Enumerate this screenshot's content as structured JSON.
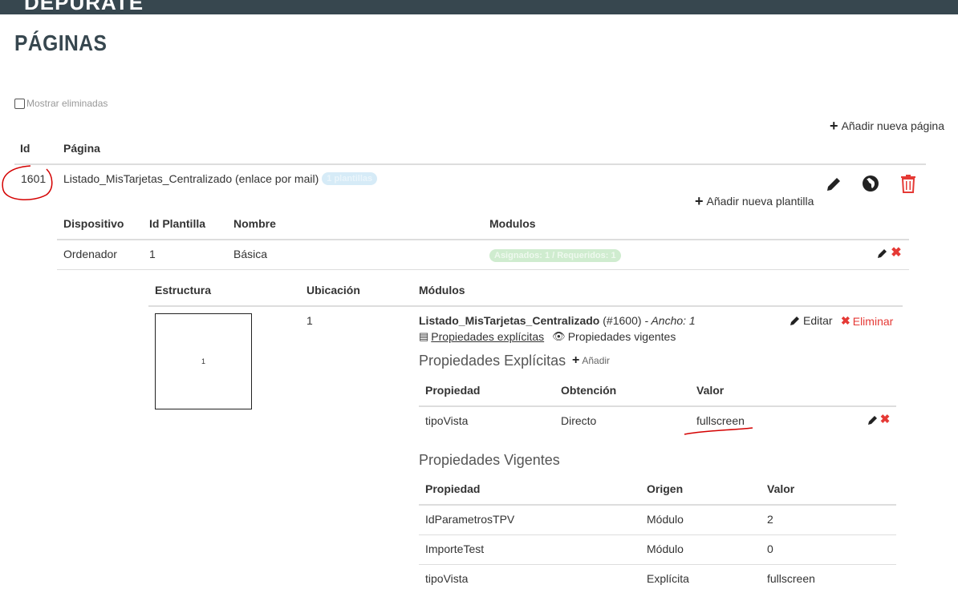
{
  "app": {
    "header_title": "DEPURATE"
  },
  "page": {
    "title": "PÁGINAS"
  },
  "filters": {
    "show_deleted_label": "Mostrar eliminadas"
  },
  "actions": {
    "add_page": "Añadir nueva página",
    "add_template": "Añadir nueva plantilla"
  },
  "pages_table": {
    "headers": {
      "id": "Id",
      "page": "Página"
    },
    "rows": [
      {
        "id": "1601",
        "name": "Listado_MisTarjetas_Centralizado (enlace por mail)",
        "badge": "1 plantillas"
      }
    ]
  },
  "templates_table": {
    "headers": {
      "device": "Dispositivo",
      "template_id": "Id Plantilla",
      "name": "Nombre",
      "modules": "Modulos"
    },
    "rows": [
      {
        "device": "Ordenador",
        "template_id": "1",
        "name": "Básica",
        "badge": "Asignados: 1 / Requeridos: 1"
      }
    ]
  },
  "structure_table": {
    "headers": {
      "structure": "Estructura",
      "location": "Ubicación",
      "modules": "Módulos"
    },
    "thumb_label": "1",
    "location": "1",
    "module": {
      "name": "Listado_MisTarjetas_Centralizado",
      "id": "(#1600)",
      "width": "- Ancho: 1",
      "explicit_link": "Propiedades explícitas",
      "current_link": "Propiedades vigentes",
      "edit": "Editar",
      "delete": "Eliminar"
    }
  },
  "explicit_props": {
    "title": "Propiedades Explícitas",
    "add": "Añadir",
    "headers": {
      "property": "Propiedad",
      "obtention": "Obtención",
      "value": "Valor"
    },
    "rows": [
      {
        "property": "tipoVista",
        "obtention": "Directo",
        "value": "fullscreen"
      }
    ]
  },
  "current_props": {
    "title": "Propiedades Vigentes",
    "headers": {
      "property": "Propiedad",
      "origin": "Origen",
      "value": "Valor"
    },
    "rows": [
      {
        "property": "IdParametrosTPV",
        "origin": "Módulo",
        "value": "2"
      },
      {
        "property": "ImporteTest",
        "origin": "Módulo",
        "value": "0"
      },
      {
        "property": "tipoVista",
        "origin": "Explícita",
        "value": "fullscreen"
      }
    ]
  },
  "icons": {
    "edit": "pencil-icon",
    "globe": "globe-icon",
    "trash": "trash-icon",
    "delete": "x-icon",
    "plus": "plus-icon",
    "eye": "eye-icon",
    "list": "list-icon"
  },
  "colors": {
    "header_bg": "#37474f",
    "danger": "#e53935",
    "annotation": "#d40000"
  }
}
